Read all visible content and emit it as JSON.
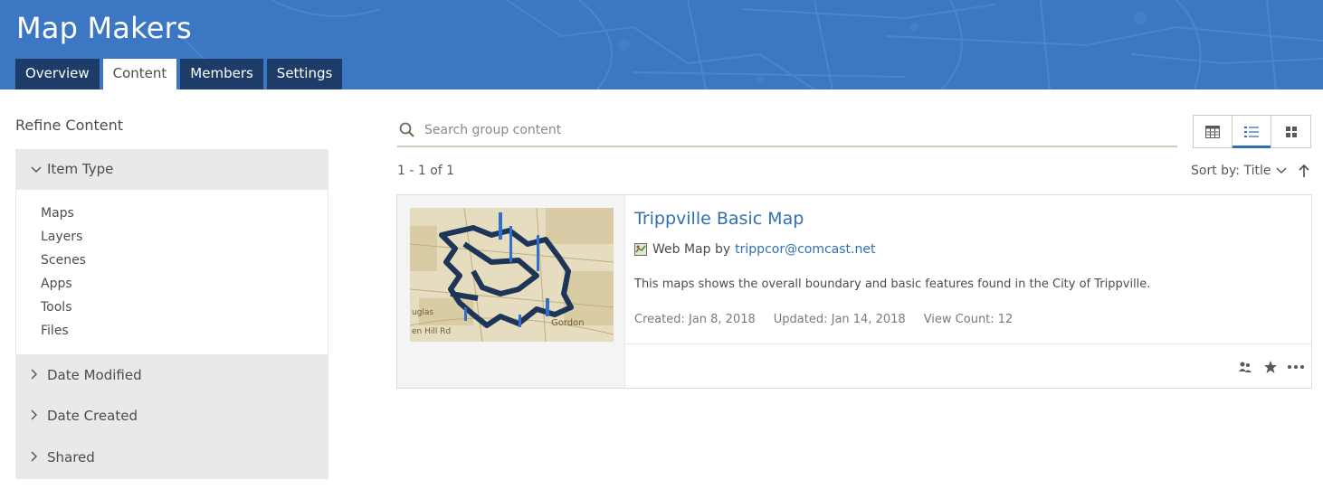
{
  "header": {
    "title": "Map Makers",
    "tabs": [
      {
        "label": "Overview",
        "active": false
      },
      {
        "label": "Content",
        "active": true
      },
      {
        "label": "Members",
        "active": false
      },
      {
        "label": "Settings",
        "active": false
      }
    ]
  },
  "sidebar": {
    "title": "Refine Content",
    "facets": [
      {
        "label": "Item Type",
        "expanded": true,
        "items": [
          "Maps",
          "Layers",
          "Scenes",
          "Apps",
          "Tools",
          "Files"
        ]
      },
      {
        "label": "Date Modified",
        "expanded": false
      },
      {
        "label": "Date Created",
        "expanded": false
      },
      {
        "label": "Shared",
        "expanded": false
      }
    ]
  },
  "search": {
    "placeholder": "Search group content",
    "value": ""
  },
  "view_modes": [
    {
      "name": "table-view",
      "active": false
    },
    {
      "name": "list-view",
      "active": true
    },
    {
      "name": "grid-view",
      "active": false
    }
  ],
  "results": {
    "count_label": "1 - 1 of 1",
    "sort_label": "Sort by:",
    "sort_value": "Title",
    "sort_direction": "ascending"
  },
  "items": [
    {
      "title": "Trippville Basic Map",
      "type": "Web Map",
      "by": "by",
      "owner": "trippcor@comcast.net",
      "description": "This maps shows the overall boundary and basic features found in the City of Trippville.",
      "created": "Created: Jan 8, 2018",
      "updated": "Updated: Jan 14, 2018",
      "views": "View Count: 12"
    }
  ],
  "thumbnail_labels": [
    "Gordon",
    "en Hill Rd",
    "uglas"
  ],
  "colors": {
    "header": "#3b77c2",
    "tab": "#1e3c68",
    "link": "#2f6fb2",
    "sidebar": "#e9e9e9"
  },
  "icons": [
    "search-icon",
    "table-icon",
    "list-icon",
    "grid-icon",
    "chevron-down-icon",
    "chevron-right-icon",
    "arrow-up-icon",
    "web-map-icon",
    "group-icon",
    "star-icon",
    "more-icon"
  ]
}
